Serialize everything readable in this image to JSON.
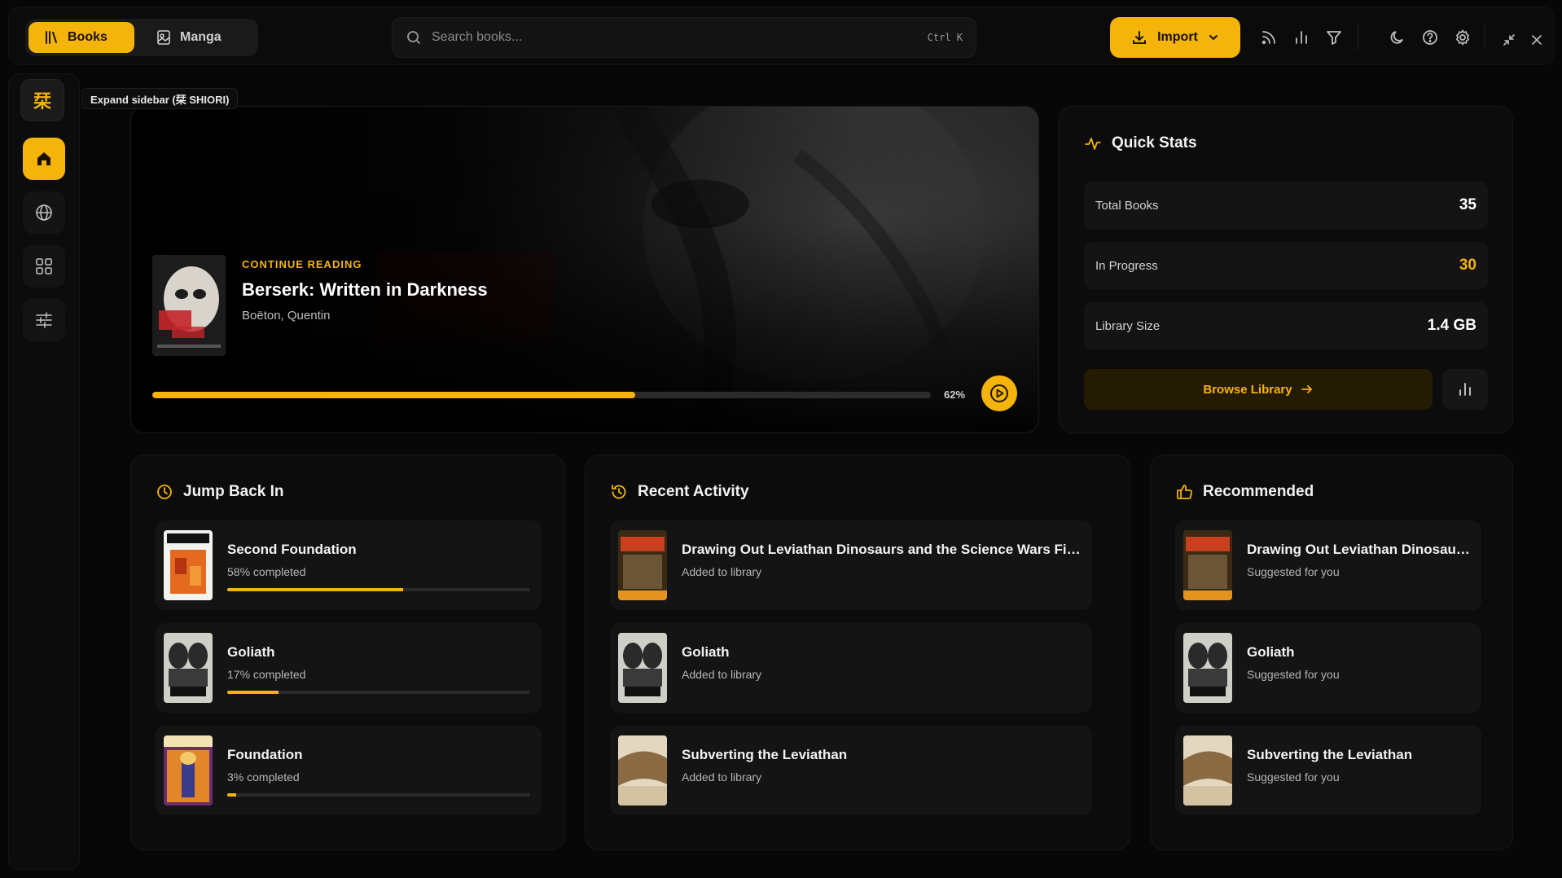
{
  "topbar": {
    "tabs": [
      {
        "label": "Books",
        "active": true,
        "icon": "library-icon"
      },
      {
        "label": "Manga",
        "active": false,
        "icon": "image-icon"
      }
    ],
    "search": {
      "placeholder": "Search books...",
      "shortcut": "Ctrl K"
    },
    "import_label": "Import",
    "tools": [
      "rss-icon",
      "bar-chart-icon",
      "filter-icon",
      "moon-icon",
      "help-icon",
      "settings-icon",
      "minimize-icon",
      "close-icon"
    ]
  },
  "sidebar": {
    "logo": "栞",
    "tooltip": "Expand sidebar (栞 SHIORI)",
    "items": [
      {
        "icon": "home-icon",
        "active": true
      },
      {
        "icon": "globe-icon",
        "active": false
      },
      {
        "icon": "grid-icon",
        "active": false
      },
      {
        "icon": "sliders-icon",
        "active": false
      }
    ]
  },
  "hero": {
    "kicker": "CONTINUE READING",
    "title": "Berserk: Written in Darkness",
    "author": "Boëton, Quentin",
    "progress": 0.62,
    "progress_label": "62%"
  },
  "stats": {
    "title": "Quick Stats",
    "rows": [
      {
        "label": "Total Books",
        "value": "35"
      },
      {
        "label": "In Progress",
        "value": "30"
      },
      {
        "label": "Library Size",
        "value": "1.4 GB"
      }
    ],
    "browse_label": "Browse Library"
  },
  "jump_back": {
    "title": "Jump Back In",
    "items": [
      {
        "title": "Second Foundation",
        "status": "58% completed",
        "progress": 0.58
      },
      {
        "title": "Goliath",
        "status": "17% completed",
        "progress": 0.17
      },
      {
        "title": "Foundation",
        "status": "3% completed",
        "progress": 0.03
      }
    ]
  },
  "recent": {
    "title": "Recent Activity",
    "items": [
      {
        "title": "Drawing Out Leviathan Dinosaurs and the Science Wars First ...",
        "status": "Added to library"
      },
      {
        "title": "Goliath",
        "status": "Added to library"
      },
      {
        "title": "Subverting the Leviathan",
        "status": "Added to library"
      }
    ]
  },
  "recommended": {
    "title": "Recommended",
    "items": [
      {
        "title": "Drawing Out Leviathan Dinosaur...",
        "status": "Suggested for you"
      },
      {
        "title": "Goliath",
        "status": "Suggested for you"
      },
      {
        "title": "Subverting the Leviathan",
        "status": "Suggested for you"
      }
    ]
  },
  "colors": {
    "accent": "#f5b40c",
    "background": "#070707",
    "panel": "#0c0c0c",
    "card": "#141414"
  }
}
